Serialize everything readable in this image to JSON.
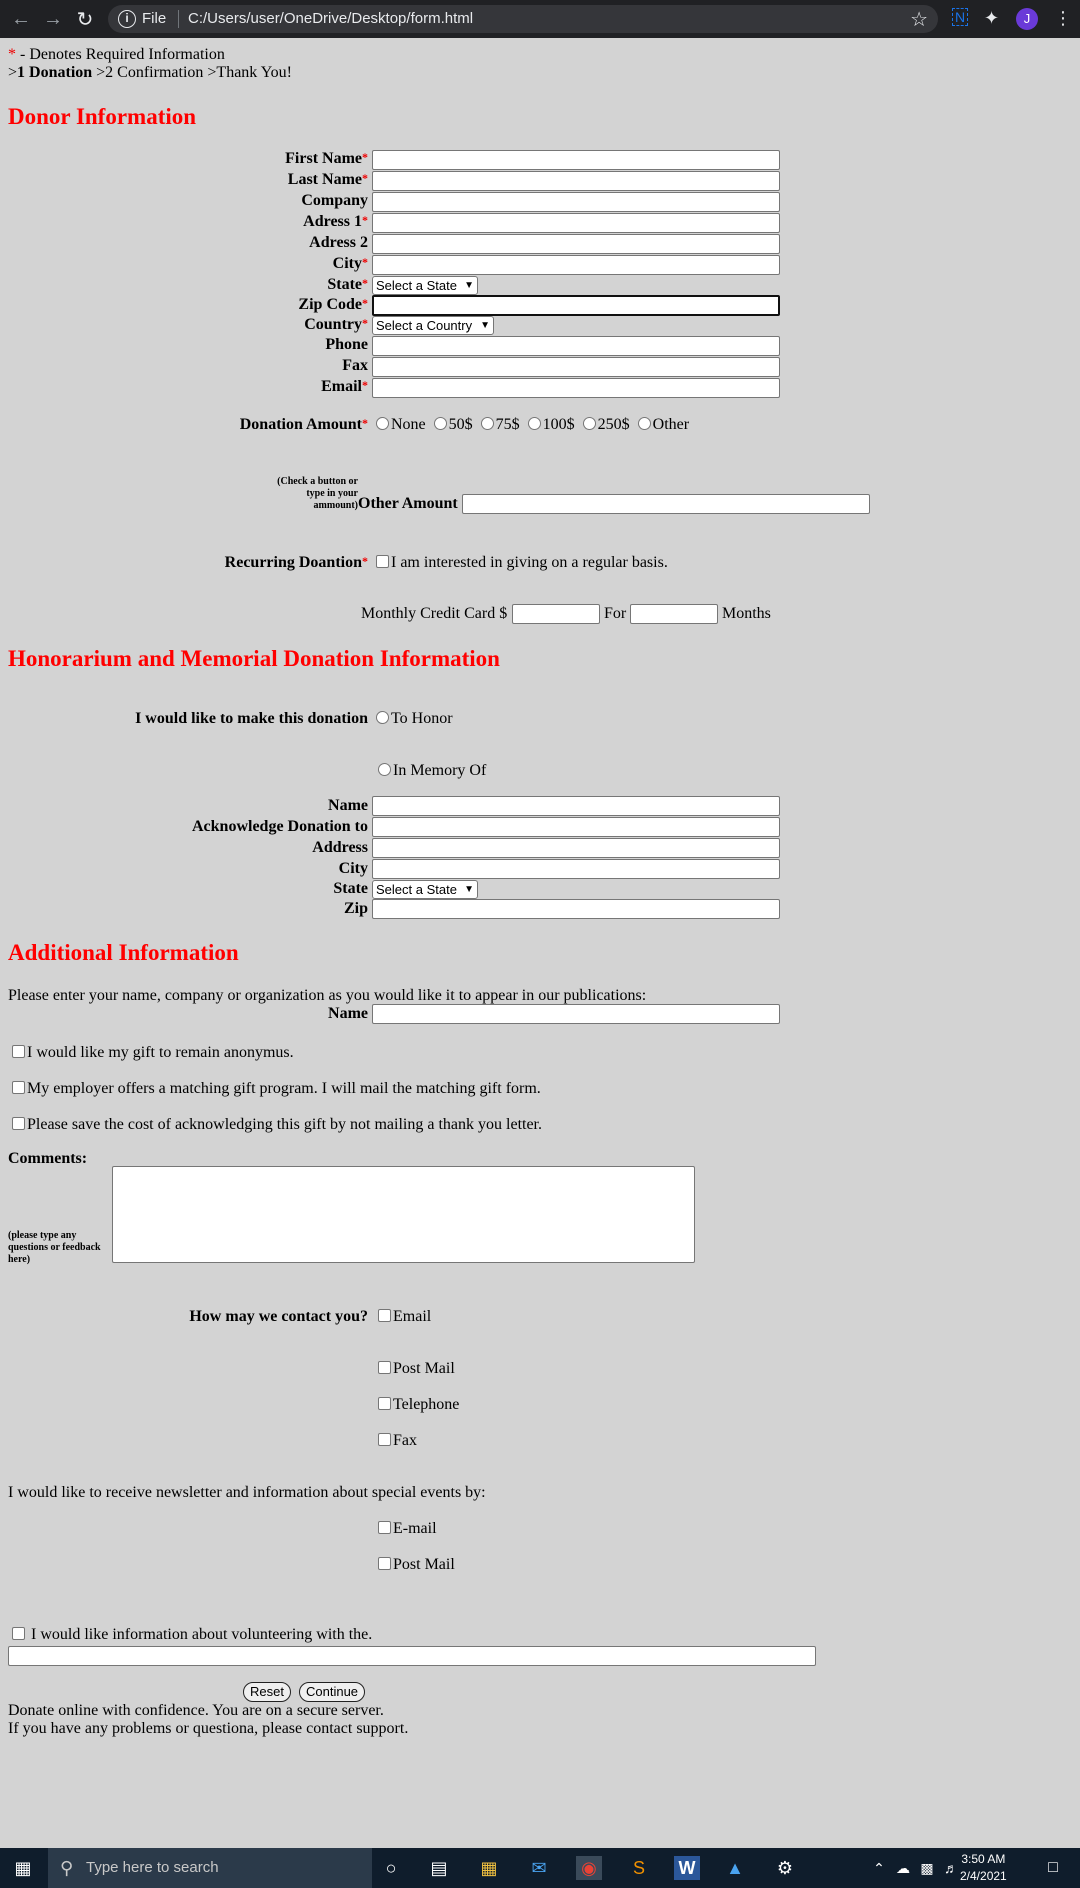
{
  "browser": {
    "protocol": "File",
    "url": "C:/Users/user/OneDrive/Desktop/form.html",
    "avatar": "J"
  },
  "header": {
    "required_star": "*",
    "required_note": " - Denotes Required Information",
    "step1_prefix": ">",
    "step1": "1 Donation",
    "step_rest": " >2 Confirmation >Thank You!"
  },
  "donor": {
    "title": "Donor Information",
    "fields": {
      "first_name": "First Name",
      "last_name": "Last Name",
      "company": "Company",
      "address1": "Adress 1",
      "address2": "Adress 2",
      "city": "City",
      "state": "State",
      "zip": "Zip Code",
      "country": "Country",
      "phone": "Phone",
      "fax": "Fax",
      "email": "Email"
    },
    "state_select": "Select a State",
    "country_select": "Select a Country",
    "donation_amount_label": "Donation Amount",
    "amount_options": [
      "None",
      "50$",
      "75$",
      "100$",
      "250$",
      "Other"
    ],
    "check_note": "(Check a button or type in your ammount)",
    "other_amount_label": "Other Amount",
    "recurring_label": "Recurring Doantion",
    "recurring_text": "I am interested in giving on a regular basis.",
    "monthly_label": "Monthly Credit Card $",
    "for_label": "For",
    "months_label": "Months"
  },
  "honor": {
    "title": "Honorarium and Memorial Donation Information",
    "make_label": "I would like to make this donation",
    "to_honor": "To Honor",
    "in_memory": "In Memory Of",
    "name": "Name",
    "acknowledge": "Acknowledge Donation to",
    "address": "Address",
    "city": "City",
    "state": "State",
    "state_select": "Select a State",
    "zip": "Zip"
  },
  "additional": {
    "title": "Additional Information",
    "publication_text": "Please enter your name, company or organization as you would like it to appear in our publications:",
    "name_label": "Name",
    "anonymous": "I would like my gift to remain anonymus.",
    "matching": "My employer offers a matching gift program. I will mail the matching gift form.",
    "no_letter": "Please save the cost of acknowledging this gift by not mailing a thank you letter.",
    "comments_label": "Comments:",
    "comments_note": "(please type any questions or feedback here)",
    "contact_label": "How may we contact you?",
    "contact_options": [
      "Email",
      "Post Mail",
      "Telephone",
      "Fax"
    ],
    "newsletter_text": "I would like to receive newsletter and information about special events by:",
    "newsletter_options": [
      "E-mail",
      "Post Mail"
    ],
    "volunteer_text": " I would like information about volunteering with the.",
    "reset": "Reset",
    "continue": "Continue",
    "secure_text": "Donate online with confidence. You are on a secure server.",
    "support_text": "If you have any problems or questiona, please contact support."
  },
  "taskbar": {
    "search_placeholder": "Type here to search",
    "time": "3:50 AM",
    "date": "2/4/2021"
  }
}
